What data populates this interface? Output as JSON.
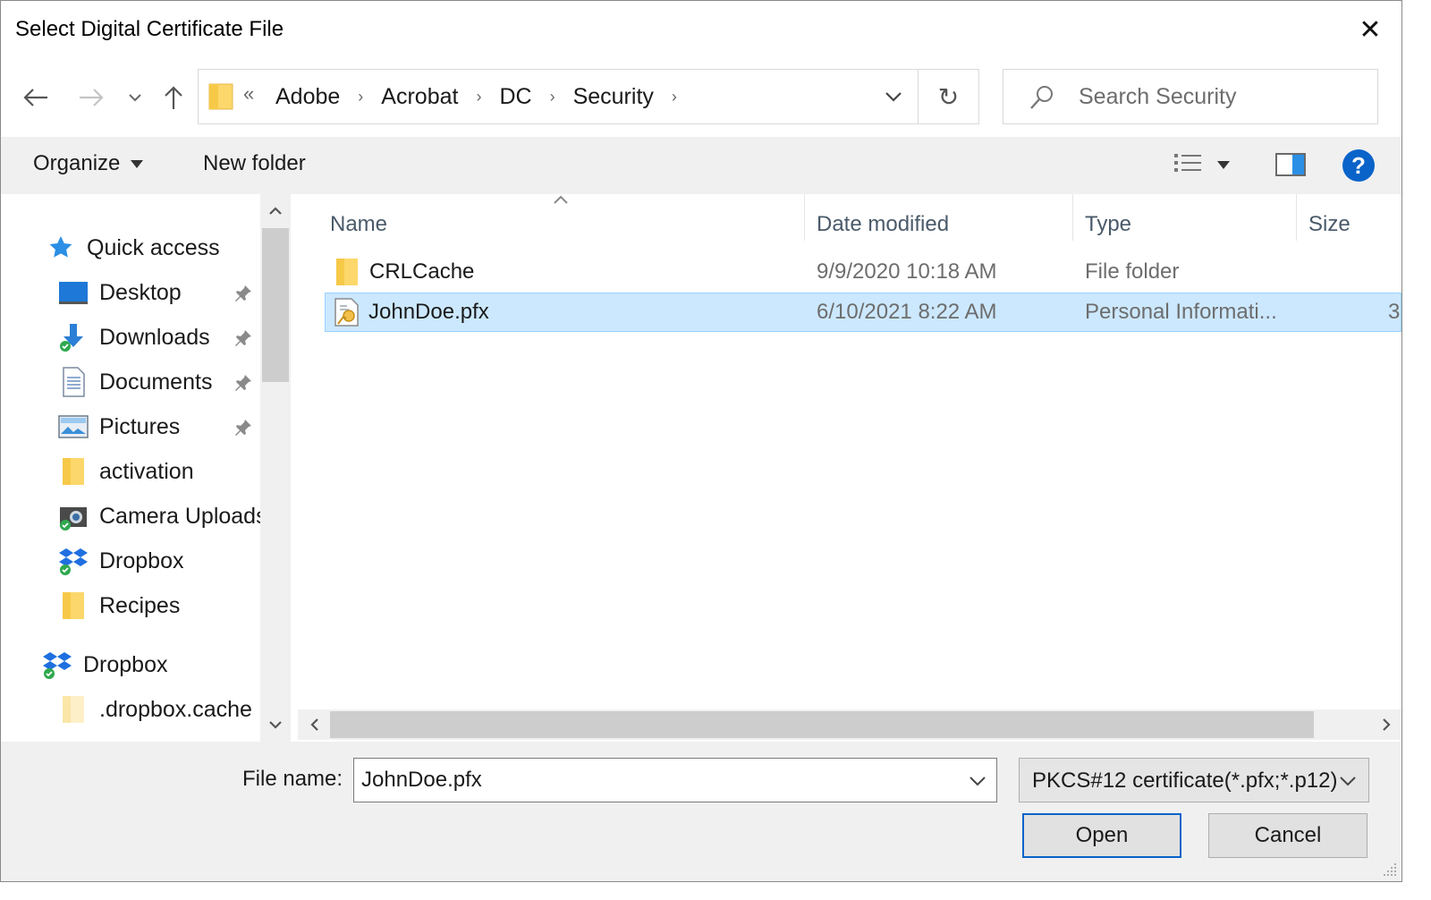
{
  "window": {
    "title": "Select Digital Certificate File",
    "close_glyph": "✕"
  },
  "address_bar": {
    "overflow_glyph": "«",
    "breadcrumbs": [
      "Adobe",
      "Acrobat",
      "DC",
      "Security"
    ],
    "separator_glyph": "›",
    "refresh_glyph": "↻"
  },
  "search": {
    "placeholder": "Search Security"
  },
  "toolbar": {
    "organize_label": "Organize",
    "new_folder_label": "New folder",
    "help_label": "?"
  },
  "nav_pane": {
    "items": [
      {
        "label": "Quick access",
        "icon": "star-icon",
        "pinned": false
      },
      {
        "label": "Desktop",
        "icon": "desktop-icon",
        "pinned": true
      },
      {
        "label": "Downloads",
        "icon": "downloads-icon",
        "pinned": true
      },
      {
        "label": "Documents",
        "icon": "documents-icon",
        "pinned": true
      },
      {
        "label": "Pictures",
        "icon": "pictures-icon",
        "pinned": true
      },
      {
        "label": "activation",
        "icon": "folder-icon",
        "pinned": false
      },
      {
        "label": "Camera Uploads",
        "icon": "camera-uploads-icon",
        "pinned": false
      },
      {
        "label": "Dropbox",
        "icon": "dropbox-icon",
        "pinned": false
      },
      {
        "label": "Recipes",
        "icon": "folder-icon",
        "pinned": false
      },
      {
        "label": "Dropbox",
        "icon": "dropbox-icon",
        "pinned": false
      },
      {
        "label": ".dropbox.cache",
        "icon": "folder-light-icon",
        "pinned": false
      }
    ]
  },
  "file_list": {
    "columns": {
      "name": "Name",
      "date": "Date modified",
      "type": "Type",
      "size": "Size"
    },
    "rows": [
      {
        "name": "CRLCache",
        "date": "9/9/2020 10:18 AM",
        "type": "File folder",
        "size": "",
        "icon": "folder-icon",
        "selected": false
      },
      {
        "name": "JohnDoe.pfx",
        "date": "6/10/2021 8:22 AM",
        "type": "Personal Informati...",
        "size": "3",
        "icon": "certificate-icon",
        "selected": true
      }
    ]
  },
  "footer": {
    "file_name_label": "File name:",
    "file_name_value": "JohnDoe.pfx",
    "file_type_filter": "PKCS#12 certificate(*.pfx;*.p12)",
    "open_label": "Open",
    "cancel_label": "Cancel"
  },
  "colors": {
    "accent": "#0a63c9",
    "selection": "#cce8ff",
    "selection_border": "#99d1ff",
    "toolbar_bg": "#f0f0f0"
  }
}
